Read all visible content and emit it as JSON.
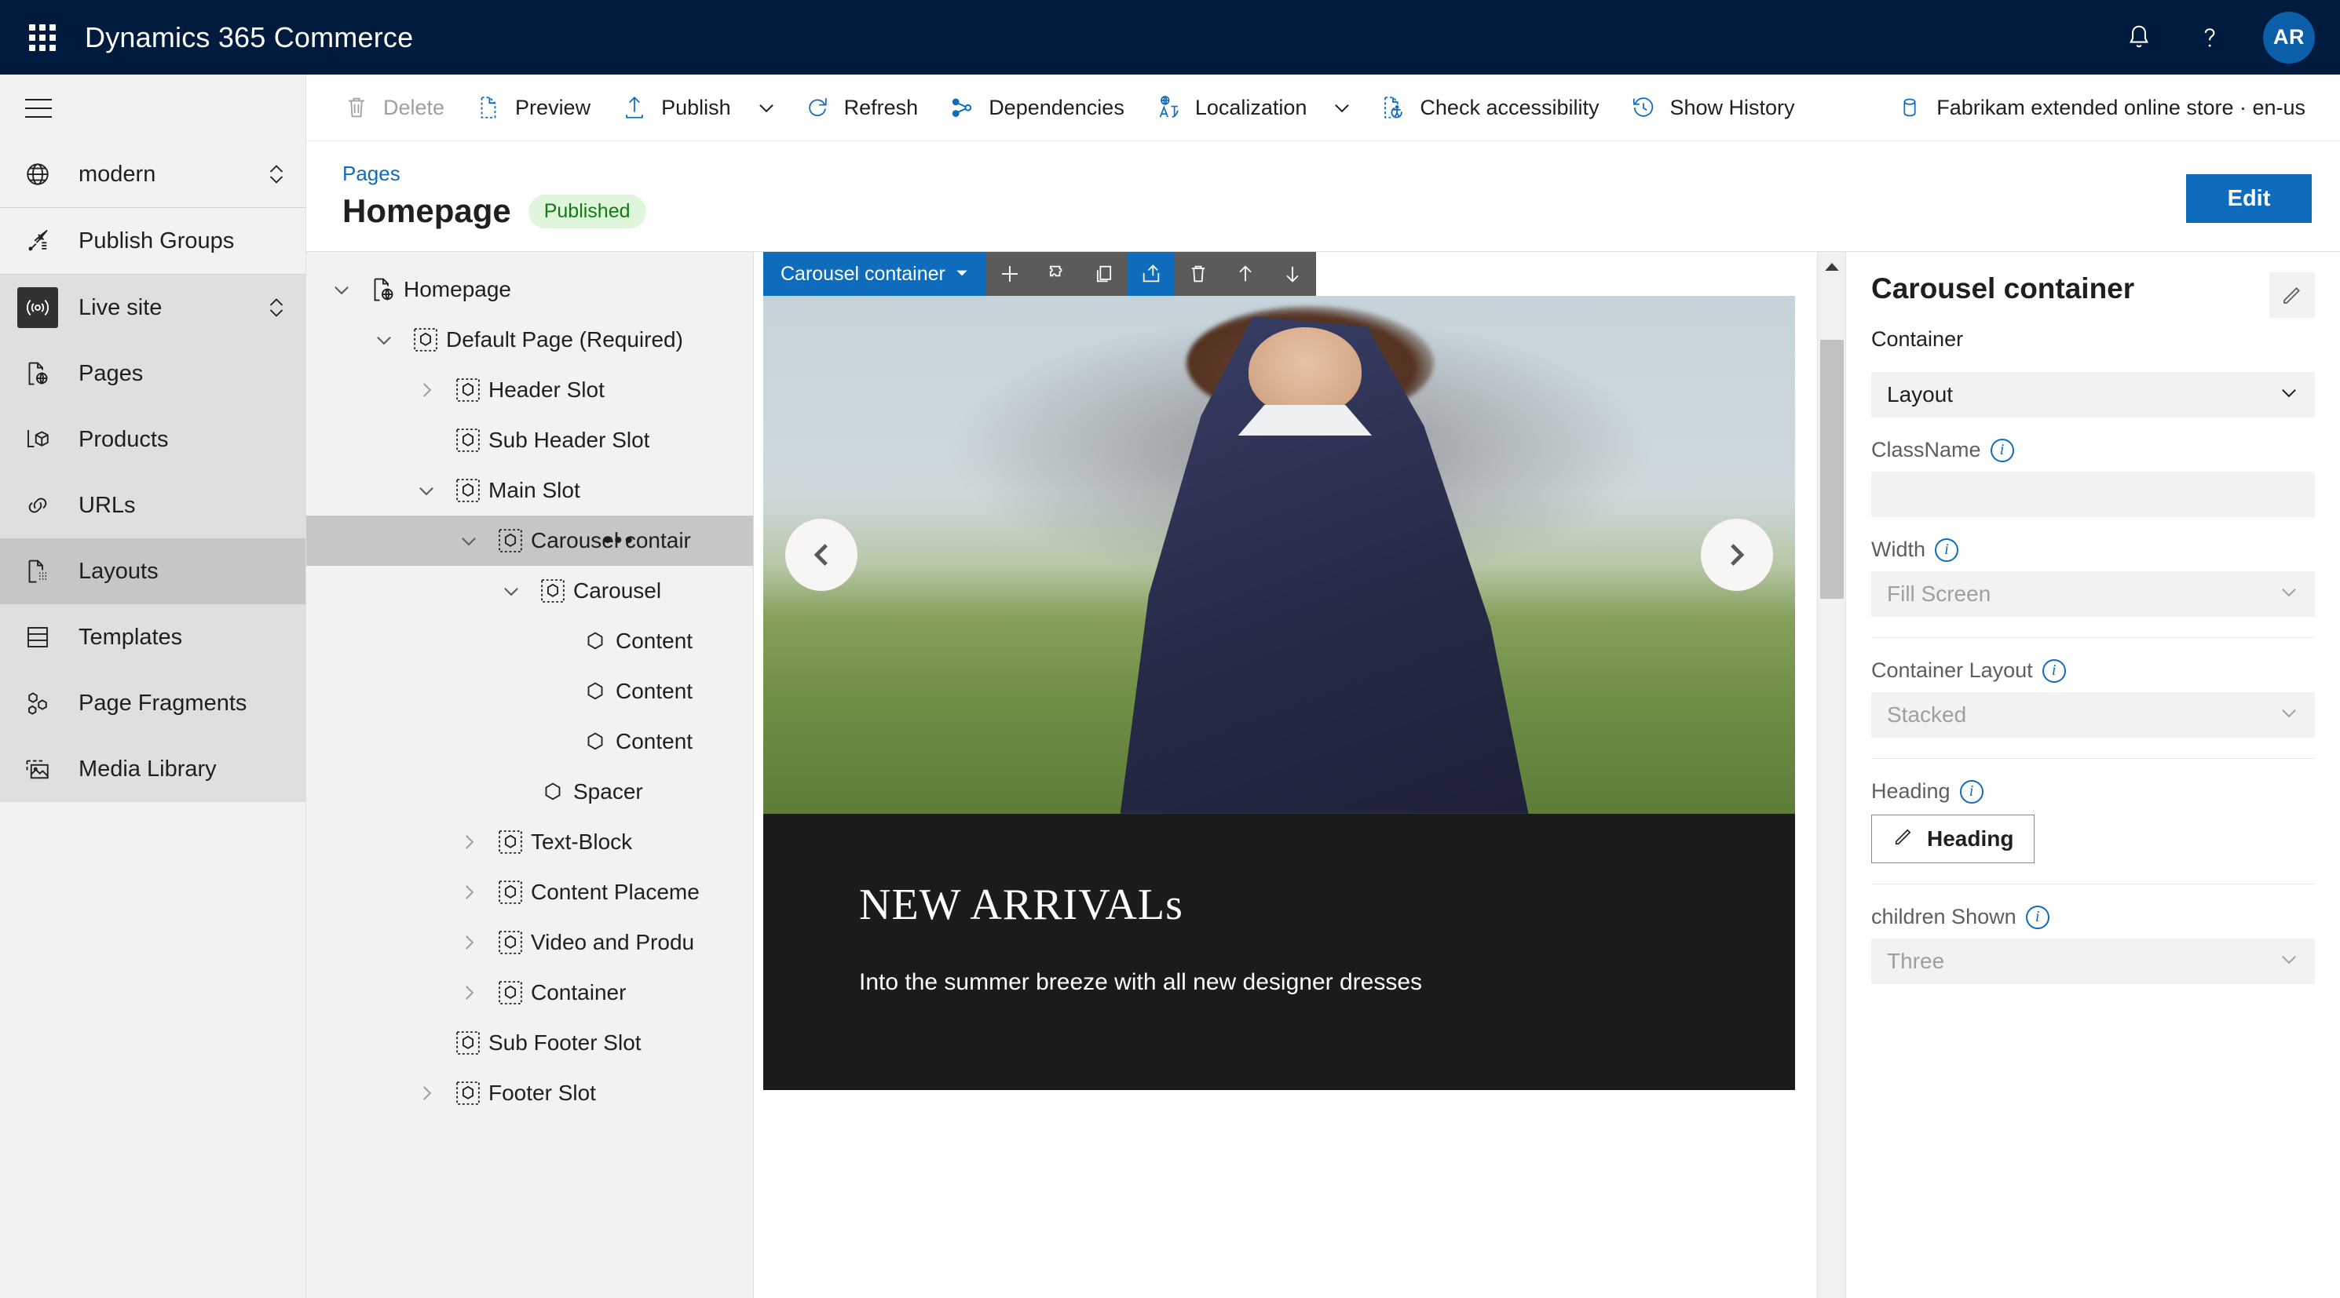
{
  "suite": {
    "waffle_icon": "app-launcher-icon",
    "title": "Dynamics 365 Commerce",
    "notifications_icon": "bell-icon",
    "help_icon": "question-icon",
    "avatar_initials": "AR"
  },
  "sidebar": {
    "menu_icon": "hamburger-icon",
    "items": [
      {
        "label": "modern",
        "icon": "globe-icon",
        "chevron": true,
        "state": "plain"
      },
      {
        "label": "Publish Groups",
        "icon": "rocket-icon",
        "chevron": false,
        "state": "plain"
      },
      {
        "label": "Live site",
        "icon": "broadcast-icon",
        "chevron": true,
        "state": "selected-dark"
      },
      {
        "label": "Pages",
        "icon": "page-globe-icon",
        "chevron": false,
        "state": "alt"
      },
      {
        "label": "Products",
        "icon": "product-box-icon",
        "chevron": false,
        "state": "alt"
      },
      {
        "label": "URLs",
        "icon": "link-icon",
        "chevron": false,
        "state": "alt"
      },
      {
        "label": "Layouts",
        "icon": "layout-page-icon",
        "chevron": false,
        "state": "row-selected"
      },
      {
        "label": "Templates",
        "icon": "template-icon",
        "chevron": false,
        "state": "alt"
      },
      {
        "label": "Page Fragments",
        "icon": "fragments-icon",
        "chevron": false,
        "state": "alt"
      },
      {
        "label": "Media Library",
        "icon": "media-image-icon",
        "chevron": false,
        "state": "alt"
      }
    ]
  },
  "commandbar": {
    "items": [
      {
        "label": "Delete",
        "icon": "trash-icon",
        "disabled": true,
        "caret": false
      },
      {
        "label": "Preview",
        "icon": "preview-page-icon",
        "disabled": false,
        "caret": false
      },
      {
        "label": "Publish",
        "icon": "upload-icon",
        "disabled": false,
        "caret": true
      },
      {
        "label": "Refresh",
        "icon": "refresh-icon",
        "disabled": false,
        "caret": false
      },
      {
        "label": "Dependencies",
        "icon": "dependencies-icon",
        "disabled": false,
        "caret": false
      },
      {
        "label": "Localization",
        "icon": "localization-icon",
        "disabled": false,
        "caret": true
      },
      {
        "label": "Check accessibility",
        "icon": "accessibility-icon",
        "disabled": false,
        "caret": false
      },
      {
        "label": "Show History",
        "icon": "history-icon",
        "disabled": false,
        "caret": false
      }
    ],
    "context": {
      "label": "Fabrikam extended online store · en-us",
      "icon": "database-icon"
    }
  },
  "pagehead": {
    "breadcrumb": "Pages",
    "title": "Homepage",
    "status": "Published",
    "edit_button": "Edit"
  },
  "tree": {
    "nodes": [
      {
        "label": "Homepage",
        "indent": 0,
        "chevron": "down",
        "icon": "page-globe-icon",
        "selected": false,
        "dots": false
      },
      {
        "label": "Default Page (Required)",
        "indent": 1,
        "chevron": "down",
        "icon": "module-dotted-icon",
        "selected": false,
        "dots": false
      },
      {
        "label": "Header Slot",
        "indent": 2,
        "chevron": "right",
        "icon": "module-dotted-icon",
        "selected": false,
        "dots": false
      },
      {
        "label": "Sub Header Slot",
        "indent": 2,
        "chevron": "none",
        "icon": "module-dotted-icon",
        "selected": false,
        "dots": false
      },
      {
        "label": "Main Slot",
        "indent": 2,
        "chevron": "down",
        "icon": "module-dotted-icon",
        "selected": false,
        "dots": false
      },
      {
        "label": "Carousel contair",
        "indent": 3,
        "chevron": "down",
        "icon": "module-dotted-icon",
        "selected": true,
        "dots": true
      },
      {
        "label": "Carousel",
        "indent": 4,
        "chevron": "down",
        "icon": "module-dotted-icon",
        "selected": false,
        "dots": false
      },
      {
        "label": "Content",
        "indent": 5,
        "chevron": "none",
        "icon": "module-solid-icon",
        "selected": false,
        "dots": false
      },
      {
        "label": "Content",
        "indent": 5,
        "chevron": "none",
        "icon": "module-solid-icon",
        "selected": false,
        "dots": false
      },
      {
        "label": "Content",
        "indent": 5,
        "chevron": "none",
        "icon": "module-solid-icon",
        "selected": false,
        "dots": false
      },
      {
        "label": "Spacer",
        "indent": 4,
        "chevron": "none",
        "icon": "module-solid-icon",
        "selected": false,
        "dots": false
      },
      {
        "label": "Text-Block",
        "indent": 3,
        "chevron": "right",
        "icon": "module-dotted-icon",
        "selected": false,
        "dots": false
      },
      {
        "label": "Content Placeme",
        "indent": 3,
        "chevron": "right",
        "icon": "module-dotted-icon",
        "selected": false,
        "dots": false
      },
      {
        "label": "Video and Produ",
        "indent": 3,
        "chevron": "right",
        "icon": "module-dotted-icon",
        "selected": false,
        "dots": false
      },
      {
        "label": "Container",
        "indent": 3,
        "chevron": "right",
        "icon": "module-dotted-icon",
        "selected": false,
        "dots": false
      },
      {
        "label": "Sub Footer Slot",
        "indent": 2,
        "chevron": "none",
        "icon": "module-dotted-icon",
        "selected": false,
        "dots": false
      },
      {
        "label": "Footer Slot",
        "indent": 2,
        "chevron": "right",
        "icon": "module-dotted-icon",
        "selected": false,
        "dots": false
      }
    ]
  },
  "canvas": {
    "module_toolbar": {
      "name": "Carousel container",
      "caret_icon": "chevron-down-icon",
      "buttons": [
        {
          "icon": "plus-icon",
          "name": "add-module-button",
          "active": false
        },
        {
          "icon": "puzzle-icon",
          "name": "replace-module-button",
          "active": false
        },
        {
          "icon": "copy-icon",
          "name": "copy-module-button",
          "active": false
        },
        {
          "icon": "share-icon",
          "name": "save-as-fragment-button",
          "active": true
        },
        {
          "icon": "trash-icon",
          "name": "delete-module-button",
          "active": false
        },
        {
          "icon": "arrow-up-icon",
          "name": "move-up-button",
          "active": false
        },
        {
          "icon": "arrow-down-icon",
          "name": "move-down-button",
          "active": false
        }
      ]
    },
    "carousel": {
      "prev_icon": "chevron-left-icon",
      "next_icon": "chevron-right-icon",
      "heading": "NEW ARRIVALs",
      "subheading": "Into the summer breeze with all new designer dresses"
    },
    "scrollbar": {
      "up_icon": "scroll-up-arrow-icon"
    }
  },
  "properties": {
    "title": "Carousel container",
    "edit_icon": "pencil-icon",
    "subtitle": "Container",
    "section_dropdown": "Layout",
    "fields": [
      {
        "label": "ClassName",
        "type": "text",
        "value": ""
      },
      {
        "label": "Width",
        "type": "select",
        "value": "Fill Screen"
      },
      {
        "label": "Container Layout",
        "type": "select",
        "value": "Stacked"
      },
      {
        "label": "Heading",
        "type": "button",
        "value": "Heading"
      },
      {
        "label": "children Shown",
        "type": "select",
        "value": "Three"
      }
    ],
    "info_icon": "info-icon",
    "chevron_icon": "chevron-down-icon"
  },
  "colors": {
    "suite_bg": "#001b3d",
    "accent": "#0f6cbd",
    "badge_bg": "#dff6dd",
    "badge_text": "#107c10",
    "nav_bg": "#f3f2f1",
    "selected_row": "#c8c6c4"
  }
}
